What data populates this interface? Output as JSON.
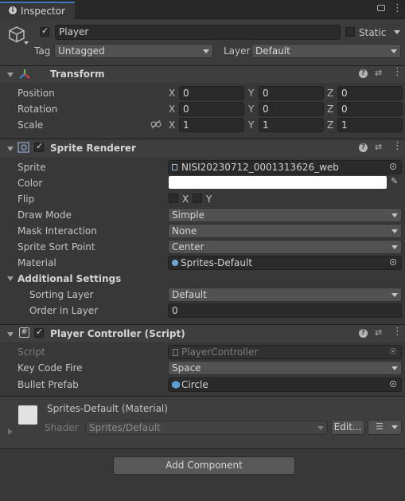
{
  "tab": {
    "title": "Inspector"
  },
  "object": {
    "name": "Player",
    "static_label": "Static",
    "tag_label": "Tag",
    "tag_value": "Untagged",
    "layer_label": "Layer",
    "layer_value": "Default"
  },
  "transform": {
    "title": "Transform",
    "rows": [
      {
        "label": "Position",
        "x": "0",
        "y": "0",
        "z": "0"
      },
      {
        "label": "Rotation",
        "x": "0",
        "y": "0",
        "z": "0"
      },
      {
        "label": "Scale",
        "x": "1",
        "y": "1",
        "z": "1"
      }
    ],
    "axis": {
      "x": "X",
      "y": "Y",
      "z": "Z"
    }
  },
  "sprite_renderer": {
    "title": "Sprite Renderer",
    "sprite_label": "Sprite",
    "sprite_value": "NISI20230712_0001313626_web",
    "color_label": "Color",
    "color_value": "#ffffff",
    "flip_label": "Flip",
    "flip_x": "X",
    "flip_y": "Y",
    "draw_mode_label": "Draw Mode",
    "draw_mode_value": "Simple",
    "mask_label": "Mask Interaction",
    "mask_value": "None",
    "sort_point_label": "Sprite Sort Point",
    "sort_point_value": "Center",
    "material_label": "Material",
    "material_value": "Sprites-Default",
    "additional_label": "Additional Settings",
    "sorting_layer_label": "Sorting Layer",
    "sorting_layer_value": "Default",
    "order_label": "Order in Layer",
    "order_value": "0"
  },
  "player_controller": {
    "title": "Player Controller (Script)",
    "script_label": "Script",
    "script_value": "PlayerController",
    "key_label": "Key Code Fire",
    "key_value": "Space",
    "bullet_label": "Bullet Prefab",
    "bullet_value": "Circle"
  },
  "material": {
    "title": "Sprites-Default (Material)",
    "shader_label": "Shader",
    "shader_value": "Sprites/Default",
    "edit_label": "Edit..."
  },
  "add_component": {
    "label": "Add Component"
  },
  "icons": {
    "help": "question-circle",
    "presets": "sliders",
    "menu": "vertical-ellipsis",
    "lock": "padlock",
    "link": "chain-link"
  }
}
